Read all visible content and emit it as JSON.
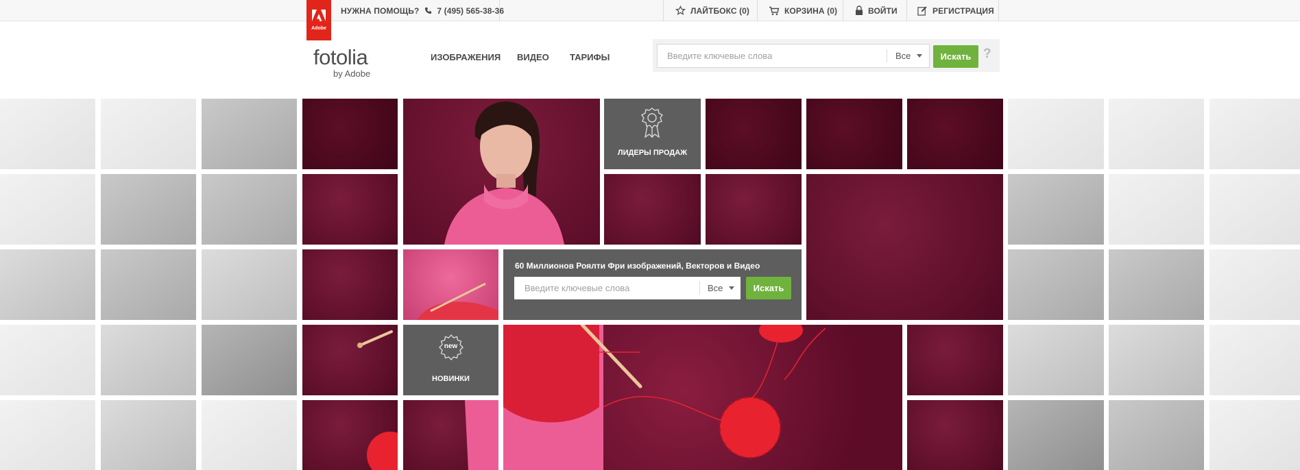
{
  "topbar": {
    "help_label": "НУЖНА ПОМОЩЬ?",
    "phone": "7 (495) 565-38-36",
    "lightbox": "ЛАЙТБОКС (0)",
    "cart": "КОРЗИНА (0)",
    "login": "ВОЙТИ",
    "register": "РЕГИСТРАЦИЯ"
  },
  "adobe": {
    "label": "Adobe"
  },
  "logo": {
    "word": "fotolia",
    "by": "by Adobe"
  },
  "nav": {
    "images": "ИЗОБРАЖЕНИЯ",
    "video": "ВИДЕО",
    "pricing": "ТАРИФЫ"
  },
  "search": {
    "placeholder": "Введите ключевые слова",
    "filter": "Все",
    "button": "Искать",
    "help": "?"
  },
  "hero": {
    "title": "60 Миллионов Роялти Фри изображений, Векторов и Видео",
    "placeholder": "Введите ключевые слова",
    "filter": "Все",
    "button": "Искать"
  },
  "tiles": {
    "bestsellers": "ЛИДЕРЫ ПРОДАЖ",
    "new": "НОВИНКИ",
    "new_badge": "new"
  },
  "colors": {
    "accent_green": "#6fb23d",
    "adobe_red": "#e1251b",
    "wine": "#6a1230",
    "panel_gray": "#5e5e5e"
  }
}
